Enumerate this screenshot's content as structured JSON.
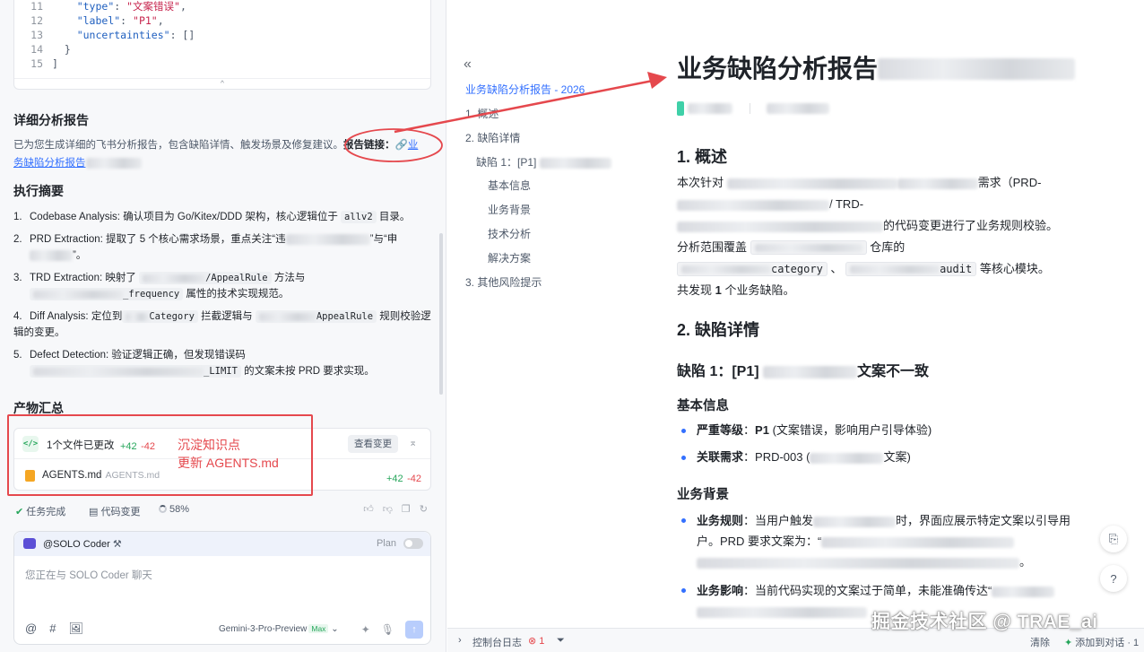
{
  "code_snippet": {
    "lines": [
      {
        "num": "11",
        "key": "\"type\"",
        "value": "\"文案错误\"",
        "trail": ","
      },
      {
        "num": "12",
        "key": "\"label\"",
        "value": "\"P1\"",
        "trail": ","
      },
      {
        "num": "13",
        "key": "\"uncertainties\"",
        "value": "[]",
        "trail": ""
      },
      {
        "num": "14",
        "text": "  }"
      },
      {
        "num": "15",
        "text": "]"
      }
    ],
    "collapse_glyph": "⌃"
  },
  "detail_report": {
    "heading": "详细分析报告",
    "desc": "已为您生成详细的飞书分析报告，包含缺陷详情、触发场景及修复建议。",
    "link_label": "报告链接：",
    "link_text_1": "业",
    "link_text_2": "务缺陷分析报告"
  },
  "summary": {
    "heading": "执行摘要",
    "items": [
      {
        "num": "1.",
        "label": "Codebase Analysis:",
        "text": "确认项目为 Go/Kitex/DDD 架构，核心逻辑位于",
        "code": "allv2",
        "tail": "目录。"
      },
      {
        "num": "2.",
        "label": "PRD Extraction:",
        "text": "提取了 5 个核心需求场景，重点关注“违",
        "mid": "”与“申",
        "tail": "”。"
      },
      {
        "num": "3.",
        "label": "TRD Extraction:",
        "text": "映射了",
        "code": "/AppealRule",
        "mid": "方法与",
        "code2": "_frequency",
        "tail": "属性的技术实现规范。"
      },
      {
        "num": "4.",
        "label": "Diff Analysis:",
        "text": "定位到",
        "code": "Category",
        "mid": "拦截逻辑与",
        "code2": "AppealRule",
        "tail": "规则校验逻辑的变更。"
      },
      {
        "num": "5.",
        "label": "Defect Detection:",
        "text": "验证逻辑正确，但发现错误码",
        "code": "_LIMIT",
        "tail": "的文案未按 PRD 要求实现。"
      }
    ]
  },
  "artifacts": {
    "heading": "产物汇总",
    "changes_title": "1个文件已更改",
    "plus": "+42",
    "minus": "-42",
    "view_button": "查看变更",
    "collapse": "⌅",
    "file_name": "AGENTS.md",
    "file_path": "AGENTS.md",
    "annotation_line1": "沉淀知识点",
    "annotation_line2": "更新 AGENTS.md"
  },
  "status": {
    "task_done": "任务完成",
    "code_changes": "代码变更",
    "progress": "58%"
  },
  "chat": {
    "agent": "@SOLO Coder",
    "plan": "Plan",
    "placeholder": "您正在与 SOLO Coder 聊天",
    "model": "Gemini-3-Pro-Preview",
    "model_badge": "Max"
  },
  "toc": {
    "items": [
      {
        "label": "业务缺陷分析报告 - 2026 ...",
        "active": true
      },
      {
        "label": "1. 概述"
      },
      {
        "label": "2. 缺陷详情"
      },
      {
        "label": "缺陷 1：[P1]"
      },
      {
        "label": "基本信息"
      },
      {
        "label": "业务背景"
      },
      {
        "label": "技术分析"
      },
      {
        "label": "解决方案"
      },
      {
        "label": "3. 其他风险提示"
      }
    ]
  },
  "doc": {
    "title": "业务缺陷分析报告",
    "s1_heading": "1. 概述",
    "s1_p1a": "本次针对",
    "s1_p1b": "需求（PRD-",
    "s1_p1c": "/ TRD-",
    "s1_p1d": "的代码变更进行了业务规则校验。",
    "s1_p2a": "分析范围覆盖",
    "s1_p2b": "仓库的",
    "s1_code1": "category",
    "s1_sep": "、",
    "s1_code2": "audit",
    "s1_p2c": "等核心模块。",
    "s1_p3a": "共发现",
    "s1_p3b": "1",
    "s1_p3c": "个业务缺陷。",
    "s2_heading": "2. 缺陷详情",
    "defect_heading_a": "缺陷 1：[P1]",
    "defect_heading_b": "文案不一致",
    "basic_heading": "基本信息",
    "sev_label": "严重等级",
    "sev_value": "P1",
    "sev_note": "(文案错误，影响用户引导体验)",
    "req_label": "关联需求",
    "req_value": "PRD-003 (",
    "req_tail": "文案)",
    "bg_heading": "业务背景",
    "rule_label": "业务规则",
    "rule_text_a": "：当用户触发",
    "rule_text_b": "时，界面应展示特定文案以引导用",
    "rule_text_c": "户。PRD 要求文案为：“",
    "rule_text_d": "。",
    "impact_label": "业务影响",
    "impact_text": "：当前代码实现的文案过于简单，未能准确传达“"
  },
  "console": {
    "label": "控制台日志",
    "error_count": "1",
    "clear": "清除",
    "add_to_chat": "添加到对话 · 1"
  },
  "brand_watermark": "掘金技术社区 @ TRAE_ai",
  "colors": {
    "accent": "#3370ff",
    "annotation_red": "#e5484d",
    "added_green": "#26a65b"
  }
}
